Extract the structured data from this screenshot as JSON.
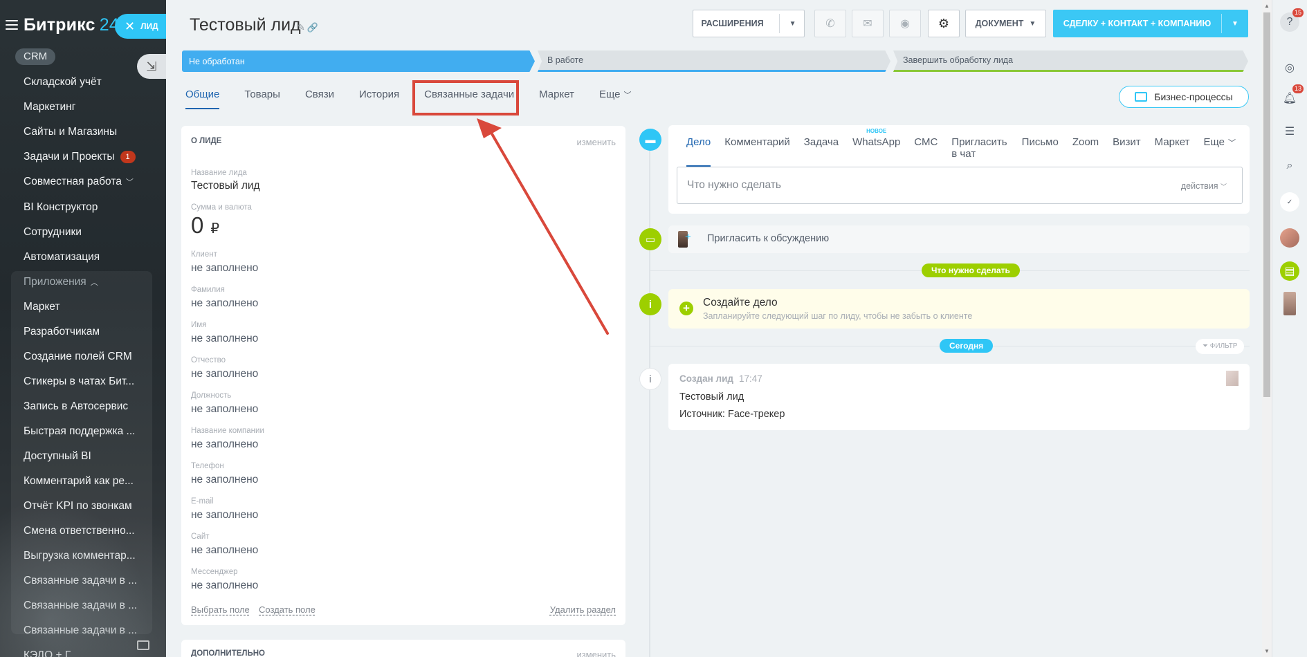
{
  "sidebar": {
    "logo_text": "Битрикс",
    "logo_num": "24",
    "lead_chip": "ЛИД",
    "crm_badge": "CRM",
    "items": [
      {
        "label": "Складской учёт"
      },
      {
        "label": "Маркетинг"
      },
      {
        "label": "Сайты и Магазины"
      },
      {
        "label": "Задачи и Проекты",
        "counter": "1"
      },
      {
        "label": "Совместная работа"
      },
      {
        "label": "BI Конструктор"
      },
      {
        "label": "Сотрудники"
      },
      {
        "label": "Автоматизация"
      },
      {
        "label": "Приложения"
      },
      {
        "label": "Маркет"
      },
      {
        "label": "Разработчикам"
      },
      {
        "label": "Создание полей CRM"
      },
      {
        "label": "Стикеры в чатах Бит..."
      },
      {
        "label": "Запись в Автосервис"
      },
      {
        "label": "Быстрая поддержка ..."
      },
      {
        "label": "Доступный BI"
      },
      {
        "label": "Комментарий как ре..."
      },
      {
        "label": "Отчёт KPI по звонкам"
      },
      {
        "label": "Смена ответственно..."
      },
      {
        "label": "Выгрузка комментар..."
      },
      {
        "label": "Связанные задачи в ..."
      },
      {
        "label": "Связанные задачи в ..."
      },
      {
        "label": "Связанные задачи в ..."
      },
      {
        "label": "КЭДО + Г..."
      }
    ]
  },
  "header": {
    "title": "Тестовый лид",
    "extensions_label": "РАСШИРЕНИЯ",
    "document_label": "ДОКУМЕНТ",
    "cta_label": "СДЕЛКУ + КОНТАКТ + КОМПАНИЮ"
  },
  "stages": [
    {
      "label": "Не обработан"
    },
    {
      "label": "В работе"
    },
    {
      "label": "Завершить обработку лида"
    }
  ],
  "tabs": [
    {
      "label": "Общие"
    },
    {
      "label": "Товары"
    },
    {
      "label": "Связи"
    },
    {
      "label": "История"
    },
    {
      "label": "Связанные задачи"
    },
    {
      "label": "Маркет"
    },
    {
      "label": "Еще"
    }
  ],
  "business_processes_label": "Бизнес-процессы",
  "about": {
    "title": "О ЛИДЕ",
    "edit_label": "изменить",
    "fields": [
      {
        "label": "Название лида",
        "value": "Тестовый лид"
      },
      {
        "label": "Сумма и валюта",
        "value": "0",
        "currency": "₽"
      },
      {
        "label": "Клиент",
        "value": "не заполнено"
      },
      {
        "label": "Фамилия",
        "value": "не заполнено"
      },
      {
        "label": "Имя",
        "value": "не заполнено"
      },
      {
        "label": "Отчество",
        "value": "не заполнено"
      },
      {
        "label": "Должность",
        "value": "не заполнено"
      },
      {
        "label": "Название компании",
        "value": "не заполнено"
      },
      {
        "label": "Телефон",
        "value": "не заполнено"
      },
      {
        "label": "E-mail",
        "value": "не заполнено"
      },
      {
        "label": "Сайт",
        "value": "не заполнено"
      },
      {
        "label": "Мессенджер",
        "value": "не заполнено"
      }
    ],
    "select_field": "Выбрать поле",
    "create_field": "Создать поле",
    "delete_section": "Удалить раздел"
  },
  "extra": {
    "title": "ДОПОЛНИТЕЛЬНО",
    "edit_label": "изменить"
  },
  "composer": {
    "tabs": [
      {
        "label": "Дело"
      },
      {
        "label": "Комментарий"
      },
      {
        "label": "Задача"
      },
      {
        "label": "WhatsApp",
        "badge": "НОВОЕ"
      },
      {
        "label": "СМС"
      },
      {
        "label": "Пригласить в чат"
      },
      {
        "label": "Письмо"
      },
      {
        "label": "Zoom"
      },
      {
        "label": "Визит"
      },
      {
        "label": "Маркет"
      },
      {
        "label": "Еще"
      }
    ],
    "placeholder": "Что нужно сделать",
    "actions_label": "действия"
  },
  "invite_text": "Пригласить к обсуждению",
  "todo_pill": "Что нужно сделать",
  "todo": {
    "title": "Создайте дело",
    "subtitle": "Запланируйте следующий шаг по лиду, чтобы не забыть о клиенте"
  },
  "today_pill": "Сегодня",
  "filter_label": "ФИЛЬТР",
  "event": {
    "title": "Создан лид",
    "time": "17:47",
    "line1": "Тестовый лид",
    "line2": "Источник: Face-трекер"
  },
  "right_panel": {
    "help_badge": "15",
    "notif_badge": "13"
  },
  "colors": {
    "accent": "#2fc6f6",
    "stage_active": "#41adf0",
    "green": "#9dcf00",
    "highlight": "#d9483b"
  }
}
